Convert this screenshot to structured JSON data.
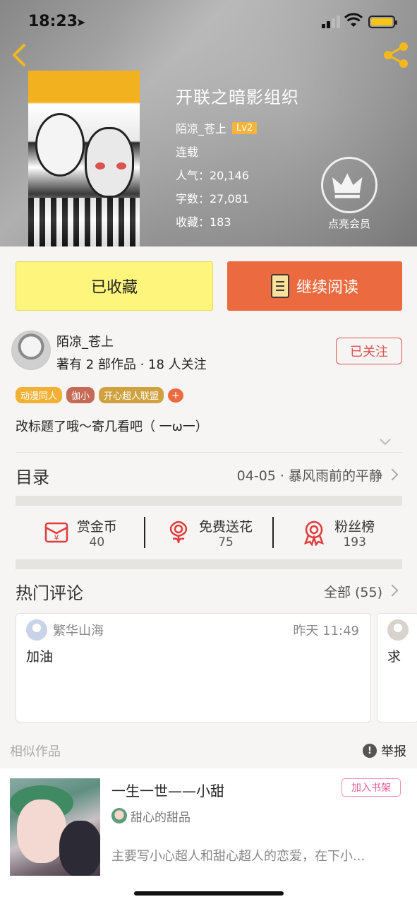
{
  "status_bar": {
    "time": "18:23",
    "location_glyph": "➤"
  },
  "book": {
    "title": "开联之暗影组织",
    "author": "陌凉_苍上",
    "author_level": "Lv2",
    "status": "连载",
    "popularity": "人气：20,146",
    "word_count": "字数：27,081",
    "favorites": "收藏：183"
  },
  "vip": {
    "label": "点亮会员"
  },
  "buttons": {
    "favorited": "已收藏",
    "continue_reading": "继续阅读"
  },
  "author_card": {
    "name": "陌凉_苍上",
    "stats": "著有 2 部作品 · 18 人关注",
    "follow_label": "已关注"
  },
  "tags": [
    {
      "label": "动漫同人",
      "color": "#f2b134"
    },
    {
      "label": "伽小",
      "color": "#c56a55"
    },
    {
      "label": "开心超人联盟",
      "color": "#d0a23f"
    }
  ],
  "tag_add": "+",
  "description": "改标题了哦～寄几看吧（ 一ω一）",
  "toc": {
    "label": "目录",
    "latest_chapter": "04-05 · 暴风雨前的平静"
  },
  "actions": [
    {
      "label": "赏金币",
      "count": "40",
      "icon": "coin-envelope-icon"
    },
    {
      "label": "免费送花",
      "count": "75",
      "icon": "flower-icon"
    },
    {
      "label": "粉丝榜",
      "count": "193",
      "icon": "medal-icon"
    }
  ],
  "comments": {
    "label": "热门评论",
    "all": "全部 (55)",
    "items": [
      {
        "user": "繁华山海",
        "time": "昨天 11:49",
        "text": "加油"
      },
      {
        "user": "",
        "time": "",
        "text": "求"
      }
    ]
  },
  "similar": {
    "label": "相似作品",
    "report": "举报",
    "report_icon": "!",
    "item": {
      "title": "一生一世——小甜",
      "add_shelf": "加入书架",
      "author": "甜心的甜品",
      "desc": "主要写小心超人和甜心超人的恋爱，在下小..."
    }
  },
  "colors": {
    "accent_orange": "#ec6a3f",
    "fav_yellow": "#fdf57c",
    "follow_red": "#e05353"
  }
}
